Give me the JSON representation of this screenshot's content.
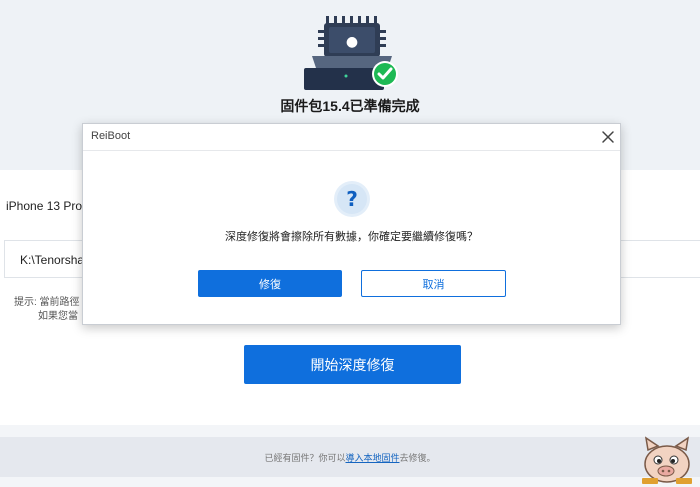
{
  "header": {
    "title": "固件包15.4已準備完成"
  },
  "device": {
    "name": "iPhone 13 Pro"
  },
  "firmware_path": {
    "value": "K:\\Tenorsha"
  },
  "hint": {
    "line1": "提示: 當前路徑",
    "line2": "如果您當"
  },
  "actions": {
    "start_label": "開始深度修復"
  },
  "footer": {
    "text_before": "已經有固件？你可以",
    "link": "導入本地固件",
    "text_after": "去修復。"
  },
  "dialog": {
    "title": "ReiBoot",
    "message": "深度修復將會擦除所有數據，你確定要繼續修復嗎？",
    "confirm_label": "修復",
    "cancel_label": "取消",
    "question_glyph": "?"
  },
  "colors": {
    "accent": "#0f6fdd",
    "success": "#1db954",
    "chip": "#2f3d55"
  }
}
